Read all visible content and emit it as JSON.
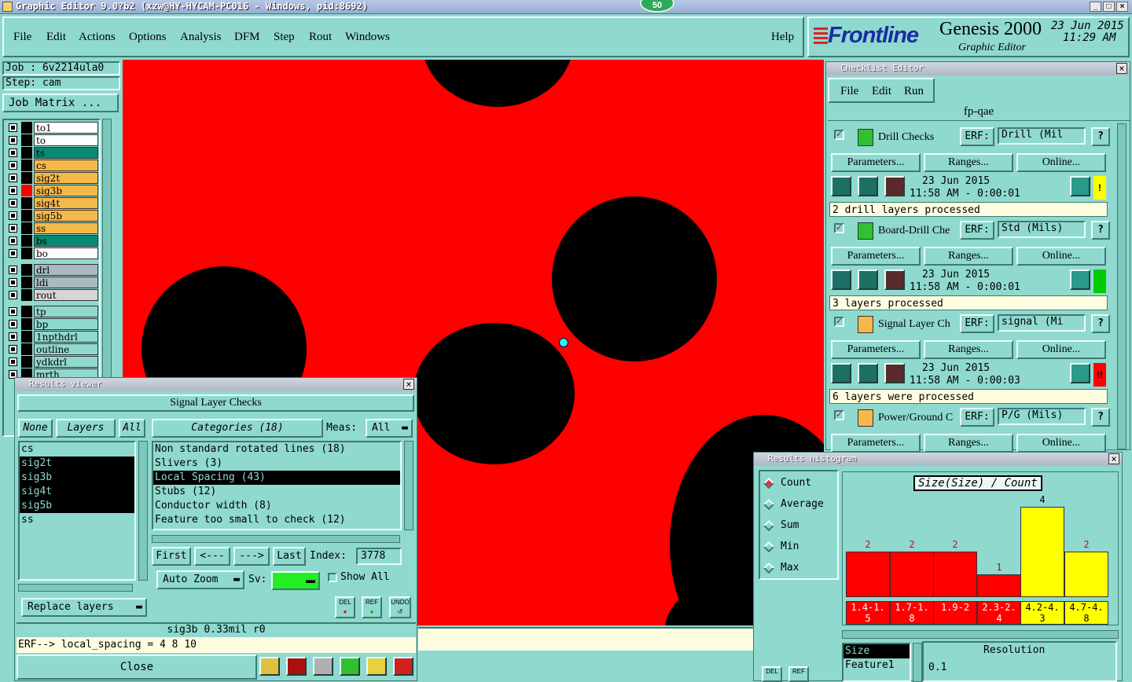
{
  "window": {
    "title": "Graphic Editor 9.0?b2 (xzw@HY-HYCAM-PC016 - Windows, pid:8692)",
    "badge": "50"
  },
  "menu": [
    "File",
    "Edit",
    "Actions",
    "Options",
    "Analysis",
    "DFM",
    "Step",
    "Rout",
    "Windows",
    "Help"
  ],
  "brand": {
    "logo": "Frontline",
    "product": "Genesis 2000",
    "subtitle": "Graphic Editor",
    "date": "23 Jun 2015",
    "time": "11:29 AM"
  },
  "left": {
    "job": "Job : 6v2214ula0",
    "step": "Step: cam",
    "job_matrix": "Job Matrix ...",
    "layers_a": [
      {
        "name": "to1",
        "color": "#ffffff"
      },
      {
        "name": "to",
        "color": "#ffffff"
      },
      {
        "name": "ts",
        "color": "#0a8a74"
      },
      {
        "name": "cs",
        "color": "#f5b84a"
      },
      {
        "name": "sig2t",
        "color": "#f5b84a"
      },
      {
        "name": "sig3b",
        "color": "#f5b84a"
      },
      {
        "name": "sig4t",
        "color": "#f5b84a"
      },
      {
        "name": "sig5b",
        "color": "#f5b84a"
      },
      {
        "name": "ss",
        "color": "#f5b84a"
      },
      {
        "name": "bs",
        "color": "#0a8a74"
      },
      {
        "name": "bo",
        "color": "#ffffff"
      }
    ],
    "layers_b": [
      {
        "name": "drl",
        "color": "#a9b9bf"
      },
      {
        "name": "ldi",
        "color": "#a9b9bf"
      },
      {
        "name": "rout",
        "color": "#d6d6d6"
      }
    ],
    "layers_c": [
      {
        "name": "tp",
        "color": "#8fd9cf"
      },
      {
        "name": "bp",
        "color": "#8fd9cf"
      },
      {
        "name": "1npthdrl",
        "color": "#8fd9cf"
      },
      {
        "name": "outline",
        "color": "#8fd9cf"
      },
      {
        "name": "ydkdrl",
        "color": "#8fd9cf"
      },
      {
        "name": "mrth",
        "color": "#8fd9cf"
      }
    ]
  },
  "results_viewer": {
    "title": "Results viewer",
    "header": "Signal Layer Checks",
    "btn_none": "None",
    "btn_layers": "Layers",
    "btn_all": "All",
    "layers": [
      "cs",
      "sig2t",
      "sig3b",
      "sig4t",
      "sig5b",
      "ss"
    ],
    "selected_layers": [
      "sig2t",
      "sig3b",
      "sig4t",
      "sig5b"
    ],
    "categories_label": "Categories (18)",
    "meas_label": "Meas:",
    "meas_value": "All",
    "categories": [
      "Non standard rotated lines (18)",
      "Slivers (3)",
      "Local Spacing (43)",
      "Stubs (12)",
      "Conductor width (8)",
      "Feature too small to check (12)"
    ],
    "selected_category": "Local Spacing (43)",
    "nav": {
      "first": "First",
      "prev": "<---",
      "next": "--->",
      "last": "Last",
      "index_label": "Index:",
      "index_value": "3778"
    },
    "auto_zoom": "Auto Zoom",
    "sv_label": "Sv:",
    "show_all": "Show All",
    "replace_layers": "Replace layers",
    "del": "DEL",
    "ref": "REF",
    "undo": "UNDO",
    "info": "sig3b 0.33mil  r0",
    "erf": "ERF--> local_spacing = 4 8 10",
    "close": "Close"
  },
  "checklist": {
    "title": "Checklist Editor",
    "menu": [
      "File",
      "Edit",
      "Run"
    ],
    "name": "fp-qae",
    "checks": [
      {
        "name": "Drill Checks",
        "erf": "Drill (Mil",
        "date": "23 Jun 2015",
        "time": "11:58 AM - 0:00:01",
        "status": "2 drill layers processed",
        "flag": "!",
        "flag_color": "#ffff00"
      },
      {
        "name": "Board-Drill Che",
        "erf": "Std (Mils)",
        "date": "23 Jun 2015",
        "time": "11:58 AM - 0:00:01",
        "status": "3 layers processed",
        "flag": "",
        "flag_color": "#00cc00"
      },
      {
        "name": "Signal Layer Ch",
        "erf": "signal (Mi",
        "date": "23 Jun 2015",
        "time": "11:58 AM - 0:00:03",
        "status": "6 layers were processed",
        "flag": "!!",
        "flag_color": "#ff0000"
      },
      {
        "name": "Power/Ground C",
        "erf": "P/G (Mils)",
        "date": "",
        "time": "",
        "status": "",
        "flag": "",
        "flag_color": ""
      }
    ],
    "erf_label": "ERF:",
    "params": "Parameters...",
    "ranges": "Ranges...",
    "online": "Online..."
  },
  "histogram": {
    "title": "Results histogram",
    "options": [
      "Count",
      "Average",
      "Sum",
      "Min",
      "Max"
    ],
    "selected": "Count",
    "chart_title": "Size(Size) / Count",
    "resolution_label": "Resolution",
    "resolution_value": "0.1",
    "list": [
      "Size",
      "Feature1"
    ],
    "del": "DEL",
    "ref": "REF",
    "colors": {
      "red": "#ff0000",
      "yellow": "#ffff00"
    }
  },
  "chart_data": {
    "type": "bar",
    "title": "Size(Size) / Count",
    "categories": [
      "1.4-1.5",
      "1.7-1.8",
      "1.9-2",
      "2.3-2.4",
      "4.2-4.3",
      "4.7-4.8"
    ],
    "values": [
      2,
      2,
      2,
      1,
      4,
      2
    ],
    "bar_colors": [
      "#ff0000",
      "#ff0000",
      "#ff0000",
      "#ff0000",
      "#ffff00",
      "#ffff00"
    ],
    "ylim": [
      0,
      4
    ]
  }
}
